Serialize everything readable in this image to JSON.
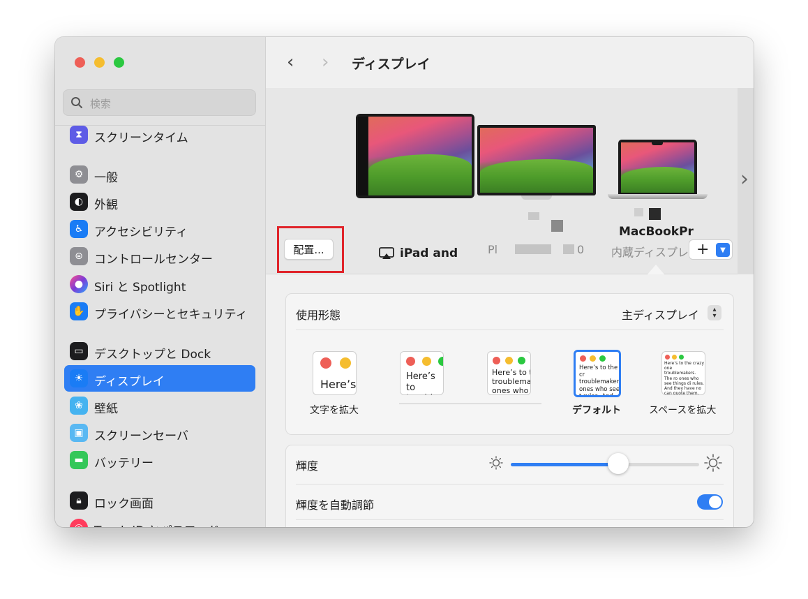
{
  "window": {
    "title": "ディスプレイ"
  },
  "search": {
    "placeholder": "検索"
  },
  "sidebar": {
    "items": [
      {
        "label": "スクリーンタイム",
        "icon": "hourglass-icon",
        "color": "#5e5ce6"
      },
      {
        "label": "一般",
        "icon": "gear-icon",
        "color": "#8e8e93"
      },
      {
        "label": "外観",
        "icon": "appearance-icon",
        "color": "#1c1c1e"
      },
      {
        "label": "アクセシビリティ",
        "icon": "accessibility-icon",
        "color": "#1a7cf5"
      },
      {
        "label": "コントロールセンター",
        "icon": "control-center-icon",
        "color": "#8e8e93"
      },
      {
        "label": "Siri と Spotlight",
        "icon": "siri-icon",
        "color": "#7d3bd6"
      },
      {
        "label": "プライバシーとセキュリティ",
        "icon": "hand-icon",
        "color": "#1a7cf5"
      },
      {
        "label": "デスクトップと Dock",
        "icon": "dock-icon",
        "color": "#1c1c1e"
      },
      {
        "label": "ディスプレイ",
        "icon": "sun-icon",
        "color": "#1a7cf5",
        "selected": true
      },
      {
        "label": "壁紙",
        "icon": "flower-icon",
        "color": "#45b3f0"
      },
      {
        "label": "スクリーンセーバ",
        "icon": "screensaver-icon",
        "color": "#59b8f2"
      },
      {
        "label": "バッテリー",
        "icon": "battery-icon",
        "color": "#34c759"
      },
      {
        "label": "ロック画面",
        "icon": "lock-icon",
        "color": "#1c1c1e"
      },
      {
        "label": "Touch ID とパスワード",
        "icon": "fingerprint-icon",
        "color": "#ff3b5c"
      }
    ]
  },
  "displays": {
    "ipad_label": "iPad and",
    "ext_sub": "Pl",
    "ext_sub_end": "0",
    "mbp_label": "MacBookPr",
    "mbp_sub": "内蔵ディスプレ"
  },
  "arrange_button": "配置...",
  "add_button": "+",
  "usage": {
    "label": "使用形態",
    "value": "主ディスプレイ"
  },
  "resolution": {
    "options": [
      {
        "caption": "文字を拡大",
        "sample": "Here’s"
      },
      {
        "caption": "",
        "sample": "Here’s to troublem"
      },
      {
        "caption": "",
        "sample": "Here’s to t troublema ones who"
      },
      {
        "caption": "デフォルト",
        "sample": "Here’s to the cr troublemakers. ones who see t rules. And they",
        "selected": true
      },
      {
        "caption": "スペースを拡大",
        "sample": "Here’s to the crazy one troublemakers. The ro ones who see things di rules. And they have no can quote them, disagr them. About the only th Because they change th"
      }
    ]
  },
  "brightness": {
    "label": "輝度",
    "level_percent": 57
  },
  "auto_brightness": {
    "label": "輝度を自動調節",
    "enabled": true
  }
}
